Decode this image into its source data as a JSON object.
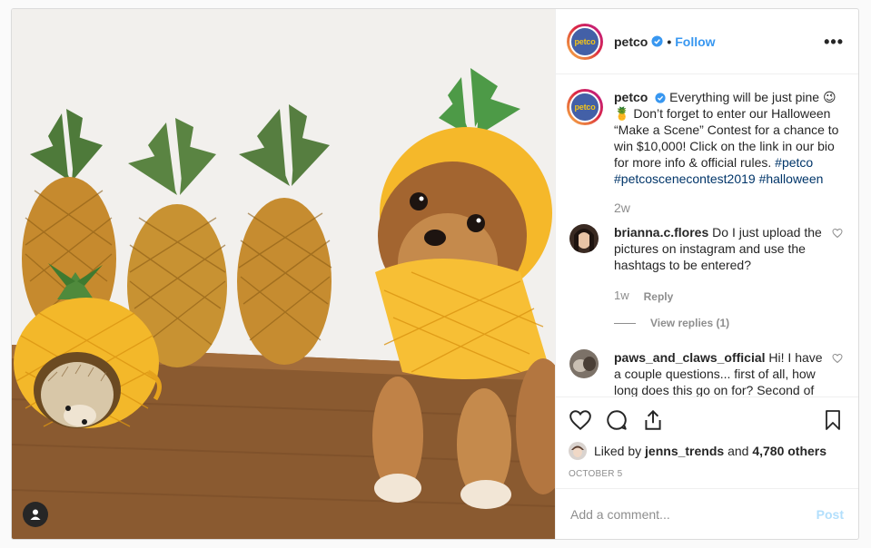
{
  "post": {
    "author": "petco",
    "avatar_text": "petco",
    "follow_label": "Follow",
    "more_label": "•••",
    "caption_text": "Everything will be just pine 😉 🍍 Don’t forget to enter our Halloween “Make a Scene” Contest for a chance to win $10,000! Click on the link in our bio for more info & official rules.",
    "hashtags": [
      "#petco",
      "#petcoscenecontest2019",
      "#halloween"
    ],
    "caption_time": "2w"
  },
  "comments": [
    {
      "user": "brianna.c.flores",
      "text": "Do I just upload the pictures on instagram and use the hashtags to be entered?",
      "time": "1w",
      "reply_label": "Reply",
      "view_replies": "View replies (1)"
    },
    {
      "user": "paws_and_claws_official",
      "text": "Hi! I have a couple questions... first of all, how long does this go on for? Second of"
    }
  ],
  "likes": {
    "prefix": "Liked by",
    "user": "jenns_trends",
    "joiner": "and",
    "others": "4,780 others"
  },
  "date": "OCTOBER 5",
  "add_comment": {
    "placeholder": "Add a comment...",
    "post_label": "Post"
  },
  "colors": {
    "link": "#3897f0",
    "hashtag": "#003569",
    "muted": "#8e8e8e",
    "post_disabled": "#b2dffc",
    "avatar_bg": "#4360a7"
  },
  "icons": [
    "verified-badge-icon",
    "more-options-icon",
    "heart-icon",
    "comment-icon",
    "share-icon",
    "bookmark-icon",
    "user-tag-icon"
  ]
}
